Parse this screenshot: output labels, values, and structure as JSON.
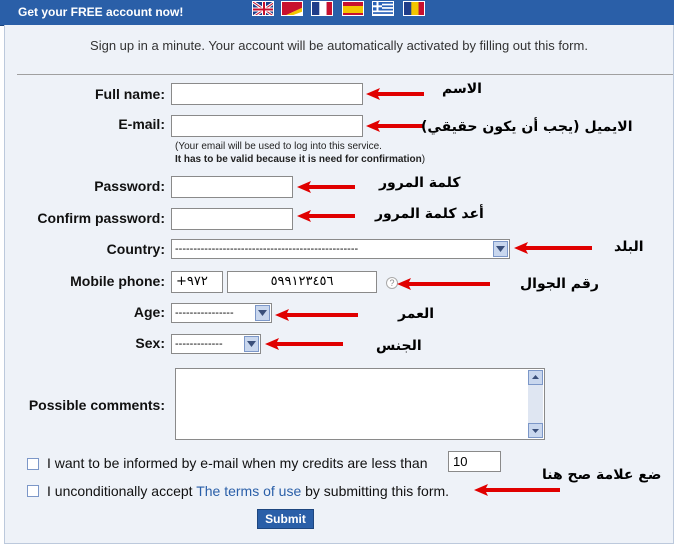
{
  "header": {
    "title": "Get your FREE account now!",
    "flags": [
      "flag-uk-icon",
      "flag-germany-icon",
      "flag-france-icon",
      "flag-spain-icon",
      "flag-greece-icon",
      "flag-romania-icon"
    ]
  },
  "subtitle": "Sign up in a minute. Your account will be automatically activated by filling out this form.",
  "form": {
    "full_name_label": "Full name:",
    "full_name_arabic": "الاسم",
    "email_label": "E-mail:",
    "email_arabic": "الايميل (يجب أن يكون حقيقي)",
    "email_note_1": "(Your email will be used to log into this service.",
    "email_note_2": "It has to be valid because it is need for confirmation",
    "email_note_2_end": ")",
    "password_label": "Password:",
    "password_arabic": "كلمة المرور",
    "confirm_label": "Confirm password:",
    "confirm_arabic": "أعد كلمة المرور",
    "country_label": "Country:",
    "country_value": "--------------------------------------------------",
    "country_arabic": "البلد",
    "mobile_label": "Mobile phone:",
    "mobile_prefix": "+٩٧٢",
    "mobile_number": "٥٩٩١٢٣٤٥٦",
    "mobile_help": "?",
    "mobile_arabic": "رقم الجوال",
    "age_label": "Age:",
    "age_value": "----------------",
    "age_arabic": "العمر",
    "sex_label": "Sex:",
    "sex_value": "-------------",
    "sex_arabic": "الجنس",
    "comments_label": "Possible comments:",
    "credits_text": "I want to be informed by e-mail when my credits are less than",
    "credits_value": "10",
    "terms_prefix": "I unconditionally accept ",
    "terms_link": "The terms of use",
    "terms_suffix": " by submitting this form.",
    "terms_arabic": "ضع علامة صح هنا",
    "submit_label": "Submit"
  },
  "colors": {
    "header_bg": "#2a5fa8",
    "panel_bg": "#eef2f8",
    "arrow": "#e00000",
    "link": "#2a5fa8"
  }
}
